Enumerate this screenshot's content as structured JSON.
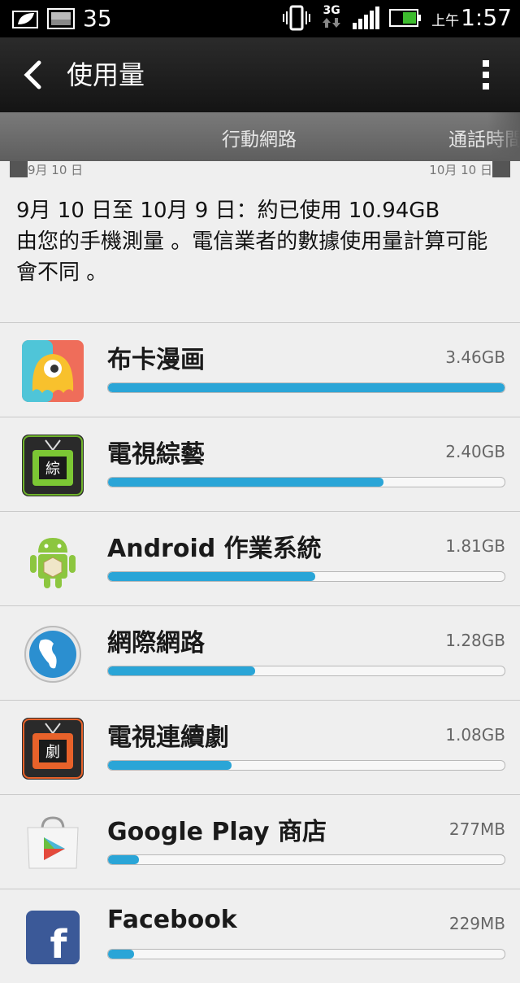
{
  "status_bar": {
    "notification_count": "35",
    "network_type": "3G",
    "ampm": "上午",
    "time": "1:57",
    "icons": [
      "leaf-icon",
      "image-icon",
      "vibrate-icon",
      "3g-icon",
      "signal-icon",
      "battery-icon"
    ]
  },
  "action_bar": {
    "title": "使用量"
  },
  "tabs": [
    {
      "label": "行動網路"
    },
    {
      "label": "通話時間"
    }
  ],
  "chart": {
    "start_label": "9月 10 日",
    "end_label": "10月 10 日"
  },
  "summary": {
    "line1": "9月 10 日至 10月 9 日：約已使用 10.94GB",
    "line2": "由您的手機測量 。電信業者的數據使用量計算可能會不同 。"
  },
  "apps": [
    {
      "name": "布卡漫画",
      "size": "3.46GB",
      "fraction": 1.0,
      "icon": "buka-comic-icon"
    },
    {
      "name": "電視綜藝",
      "size": "2.40GB",
      "fraction": 0.694,
      "icon": "tv-variety-icon"
    },
    {
      "name": "Android 作業系統",
      "size": "1.81GB",
      "fraction": 0.523,
      "icon": "android-icon"
    },
    {
      "name": "網際網路",
      "size": "1.28GB",
      "fraction": 0.37,
      "icon": "globe-icon"
    },
    {
      "name": "電視連續劇",
      "size": "1.08GB",
      "fraction": 0.312,
      "icon": "tv-drama-icon"
    },
    {
      "name": "Google Play 商店",
      "size": "277MB",
      "fraction": 0.078,
      "icon": "play-store-icon"
    },
    {
      "name": "Facebook",
      "size": "229MB",
      "fraction": 0.066,
      "icon": "facebook-icon"
    }
  ],
  "colors": {
    "accent": "#2aa5d7",
    "actionbar": "#1c1c1c",
    "tabbar": "#6f6f6f",
    "background": "#efefef"
  }
}
